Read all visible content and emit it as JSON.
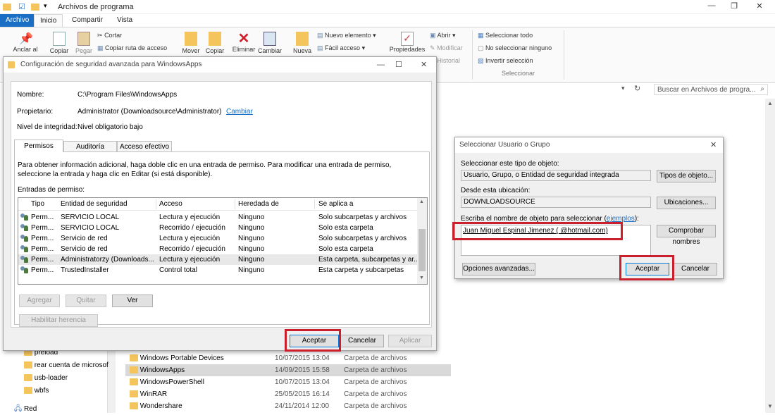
{
  "explorer": {
    "title": "Archivos de programa",
    "tabs": [
      "Archivo",
      "Inicio",
      "Compartir",
      "Vista"
    ],
    "ribbon": {
      "pin": "Anclar al",
      "copy": "Copiar",
      "paste": "Pegar",
      "cut": "Cortar",
      "copy_path": "Copiar ruta de acceso",
      "move": "Mover",
      "copy_to": "Copiar",
      "delete": "Eliminar",
      "rename": "Cambiar",
      "new": "Nueva",
      "new_item": "Nuevo elemento",
      "easy_access": "Fácil acceso",
      "properties": "Propiedades",
      "open": "Abrir",
      "modify": "Modificar",
      "history": "Historial",
      "select_all": "Seleccionar todo",
      "select_none": "No seleccionar ninguno",
      "invert": "Invertir selección",
      "select_group": "Seleccionar"
    },
    "search_placeholder": "Buscar en Archivos de progra...",
    "nav_items": [
      "preload",
      "rear cuenta de microsof",
      "usb-loader",
      "wbfs",
      "Red"
    ],
    "files": [
      {
        "name": "Windows Portable Devices",
        "date": "10/07/2015 13:04",
        "type": "Carpeta de archivos"
      },
      {
        "name": "WindowsApps",
        "date": "14/09/2015 15:58",
        "type": "Carpeta de archivos"
      },
      {
        "name": "WindowsPowerShell",
        "date": "10/07/2015 13:04",
        "type": "Carpeta de archivos"
      },
      {
        "name": "WinRAR",
        "date": "25/05/2015 16:14",
        "type": "Carpeta de archivos"
      },
      {
        "name": "Wondershare",
        "date": "24/11/2014 12:00",
        "type": "Carpeta de archivos"
      }
    ]
  },
  "security_dialog": {
    "title": "Configuración de seguridad avanzada para WindowsApps",
    "name_label": "Nombre:",
    "name_value": "C:\\Program Files\\WindowsApps",
    "owner_label": "Propietario:",
    "owner_value": "Administrator (Downloadsource\\Administrator)",
    "change_link": "Cambiar",
    "integrity_label": "Nivel de integridad:",
    "integrity_value": "Nivel obligatorio bajo",
    "tabs": [
      "Permisos",
      "Auditoría",
      "Acceso efectivo"
    ],
    "info_text": "Para obtener información adicional, haga doble clic en una entrada de permiso. Para modificar una entrada de permiso, seleccione la entrada y haga clic en Editar (si está disponible).",
    "entries_label": "Entradas de permiso:",
    "columns": [
      "Tipo",
      "Entidad de seguridad",
      "Acceso",
      "Heredada de",
      "Se aplica a"
    ],
    "rows": [
      [
        "Perm...",
        "SERVICIO LOCAL",
        "Lectura y ejecución",
        "Ninguno",
        "Solo subcarpetas y archivos"
      ],
      [
        "Perm...",
        "SERVICIO LOCAL",
        "Recorrido / ejecución",
        "Ninguno",
        "Solo esta carpeta"
      ],
      [
        "Perm...",
        "Servicio de red",
        "Lectura y ejecución",
        "Ninguno",
        "Solo subcarpetas y archivos"
      ],
      [
        "Perm...",
        "Servicio de red",
        "Recorrido / ejecución",
        "Ninguno",
        "Solo esta carpeta"
      ],
      [
        "Perm...",
        "Administratorzy (Downloads...",
        "Lectura y ejecución",
        "Ninguno",
        "Esta carpeta, subcarpetas y ar..."
      ],
      [
        "Perm...",
        "TrustedInstaller",
        "Control total",
        "Ninguno",
        "Esta carpeta y subcarpetas"
      ]
    ],
    "add": "Agregar",
    "remove": "Quitar",
    "view": "Ver",
    "enable_inheritance": "Habilitar herencia",
    "ok": "Aceptar",
    "cancel": "Cancelar",
    "apply": "Aplicar"
  },
  "select_dialog": {
    "title": "Seleccionar Usuario o Grupo",
    "type_label": "Seleccionar este tipo de objeto:",
    "type_value": "Usuario, Grupo, o Entidad de seguridad integrada",
    "type_button": "Tipos de objeto...",
    "location_label": "Desde esta ubicación:",
    "location_value": "DOWNLOADSOURCE",
    "location_button": "Ubicaciones...",
    "name_label": "Escriba el nombre de objeto para seleccionar",
    "examples_link": "ejemplos",
    "name_value": "Juan Miguel Espinal Jimenez (            @hotmail.com)",
    "check_names": "Comprobar nombres",
    "advanced": "Opciones avanzadas...",
    "ok": "Aceptar",
    "cancel": "Cancelar"
  },
  "colors": {
    "accent": "#1a6fc4",
    "highlight": "#cc1f2e",
    "link": "#1a6fc4"
  }
}
